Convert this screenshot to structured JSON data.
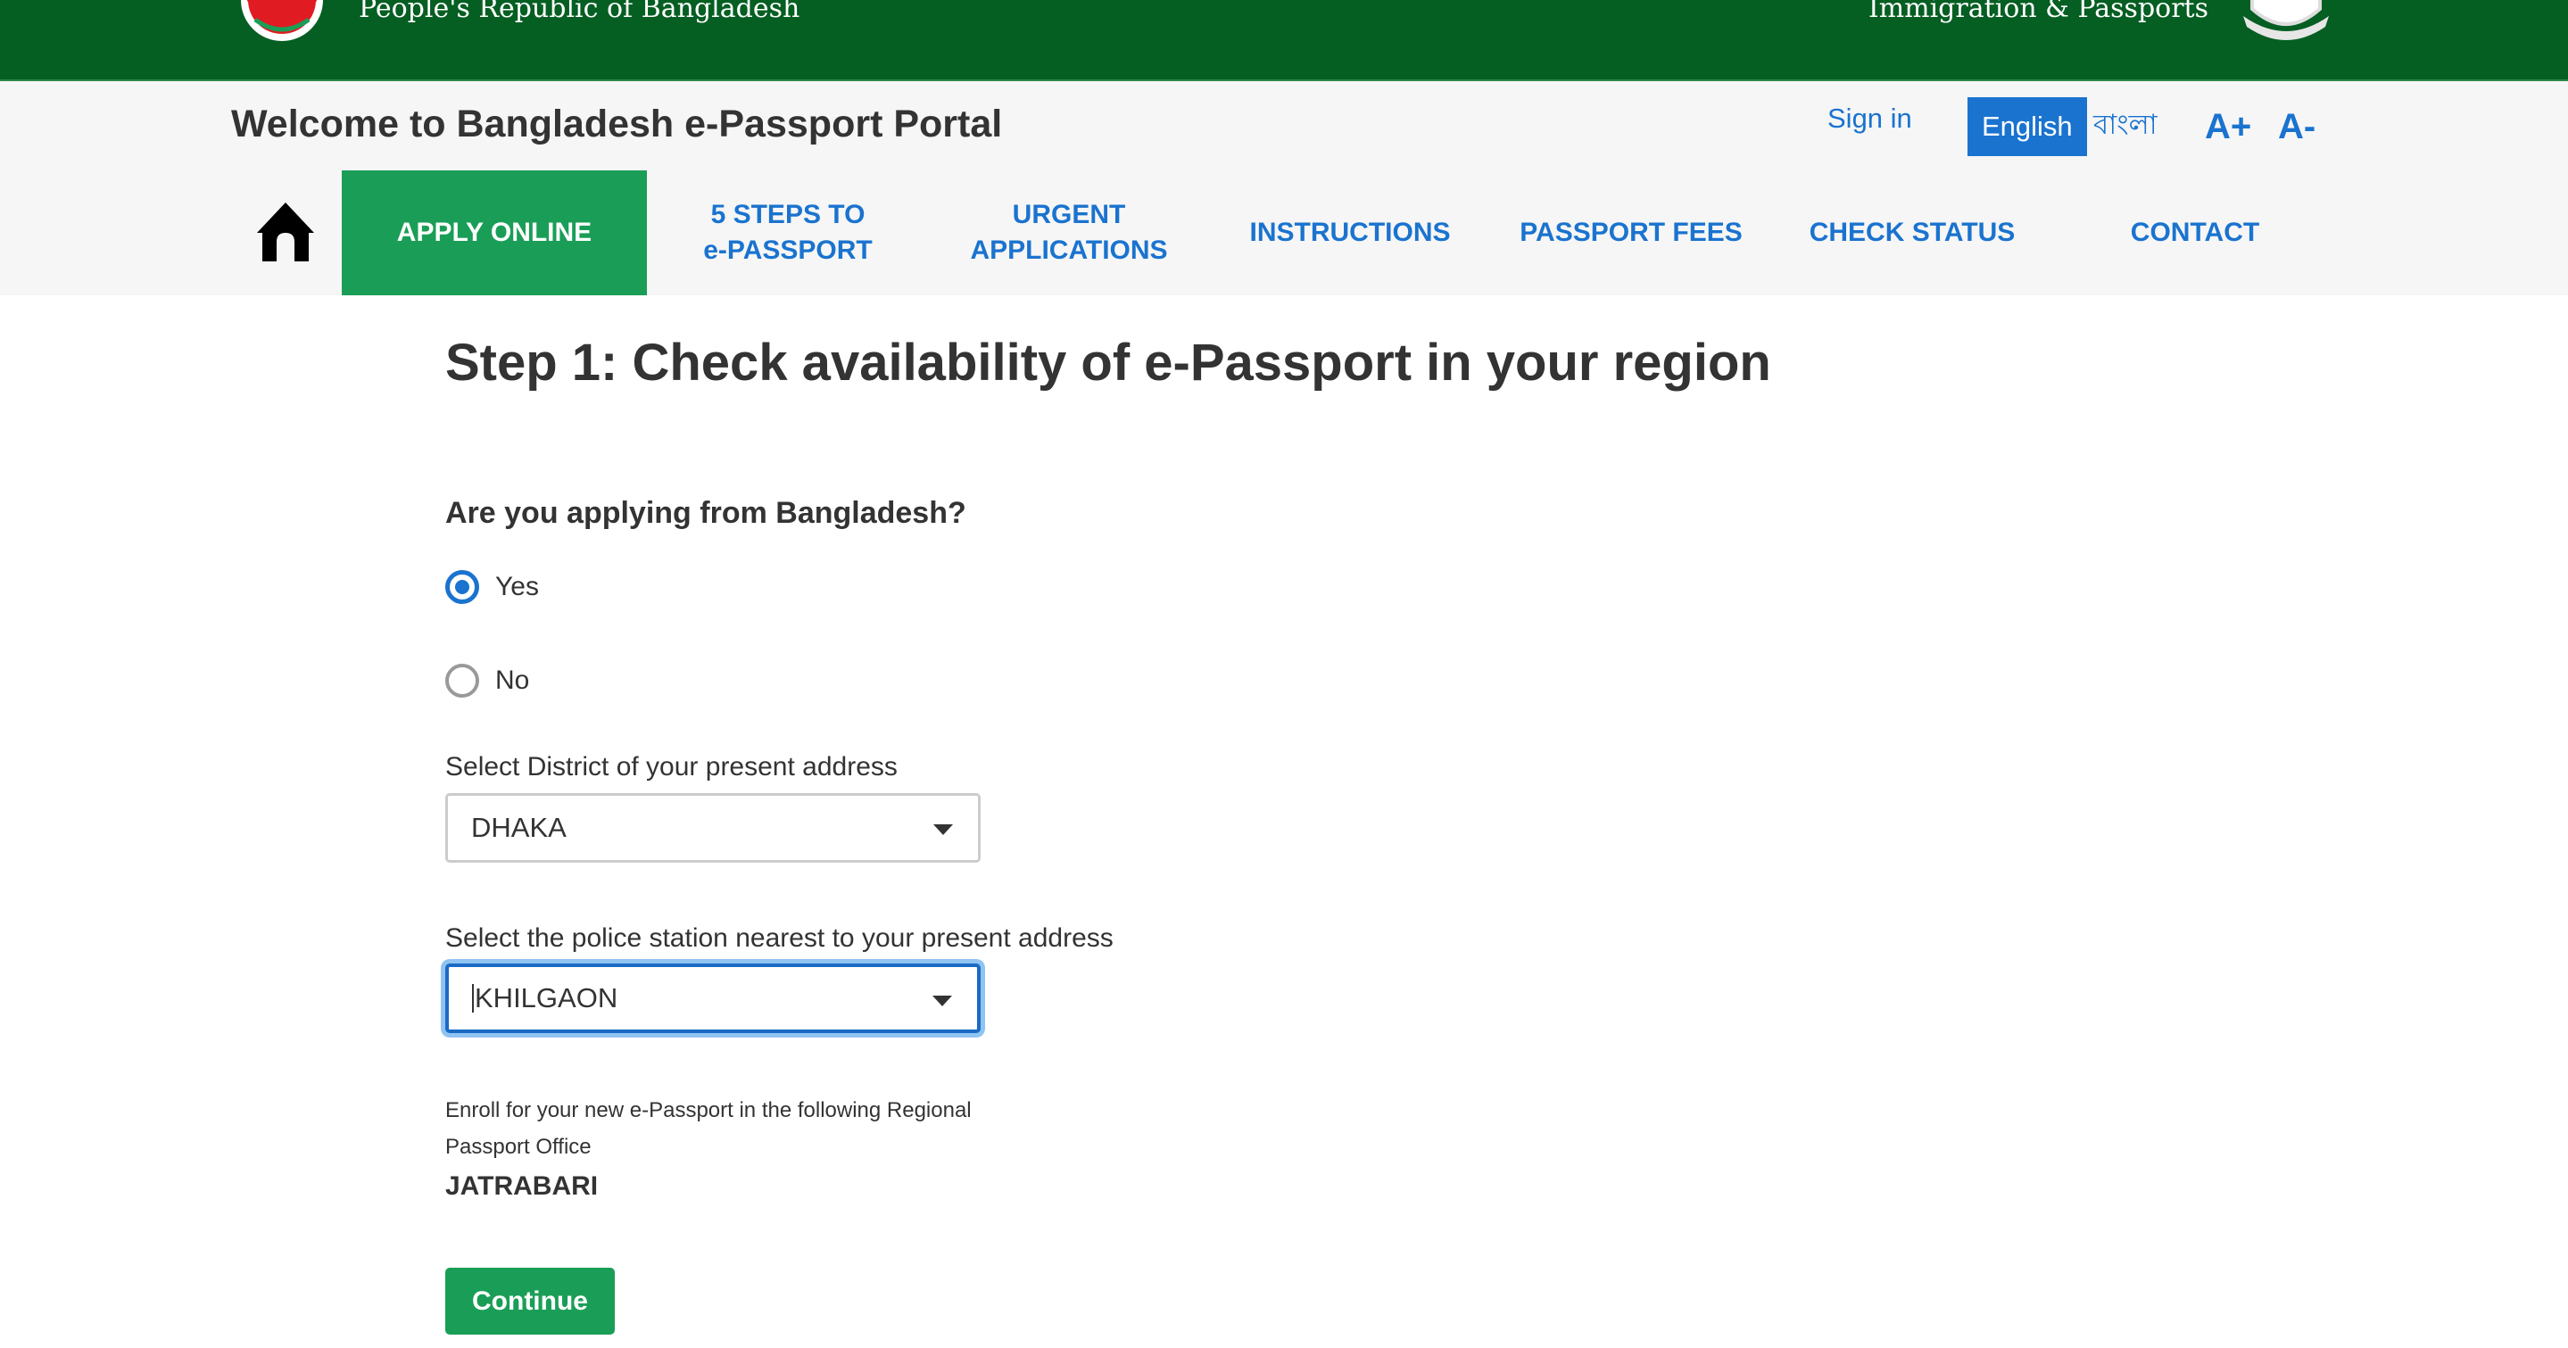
{
  "header": {
    "left_text": "People's Republic of Bangladesh",
    "right_text": "Immigration & Passports",
    "colors": {
      "header_green": "#055e22",
      "accent_green": "#1a9e57",
      "link_blue": "#1a73cf"
    }
  },
  "portal": {
    "title": "Welcome to Bangladesh e-Passport Portal",
    "sign_in": "Sign in",
    "languages": [
      {
        "label": "English",
        "active": true
      },
      {
        "label": "বাংলা",
        "active": false
      }
    ],
    "font_increase": "A+",
    "font_decrease": "A-"
  },
  "nav": {
    "home_icon": "home-icon",
    "items": [
      {
        "line1": "APPLY ONLINE",
        "line2": "",
        "active": true
      },
      {
        "line1": "5 STEPS TO",
        "line2": "e-PASSPORT",
        "active": false
      },
      {
        "line1": "URGENT",
        "line2": "APPLICATIONS",
        "active": false
      },
      {
        "line1": "INSTRUCTIONS",
        "line2": "",
        "active": false
      },
      {
        "line1": "PASSPORT FEES",
        "line2": "",
        "active": false
      },
      {
        "line1": "CHECK STATUS",
        "line2": "",
        "active": false
      },
      {
        "line1": "CONTACT",
        "line2": "",
        "active": false
      }
    ]
  },
  "form": {
    "step_title": "Step 1: Check availability of e-Passport in your region",
    "question": "Are you applying from Bangladesh?",
    "options": [
      {
        "label": "Yes",
        "checked": true
      },
      {
        "label": "No",
        "checked": false
      }
    ],
    "district_label": "Select District of your present address",
    "district_value": "DHAKA",
    "police_label": "Select the police station nearest to your present address",
    "police_value": "KHILGAON",
    "info_line1": "Enroll for your new e-Passport in the following Regional",
    "info_line2": "Passport Office",
    "office_name": "JATRABARI",
    "continue_label": "Continue"
  }
}
